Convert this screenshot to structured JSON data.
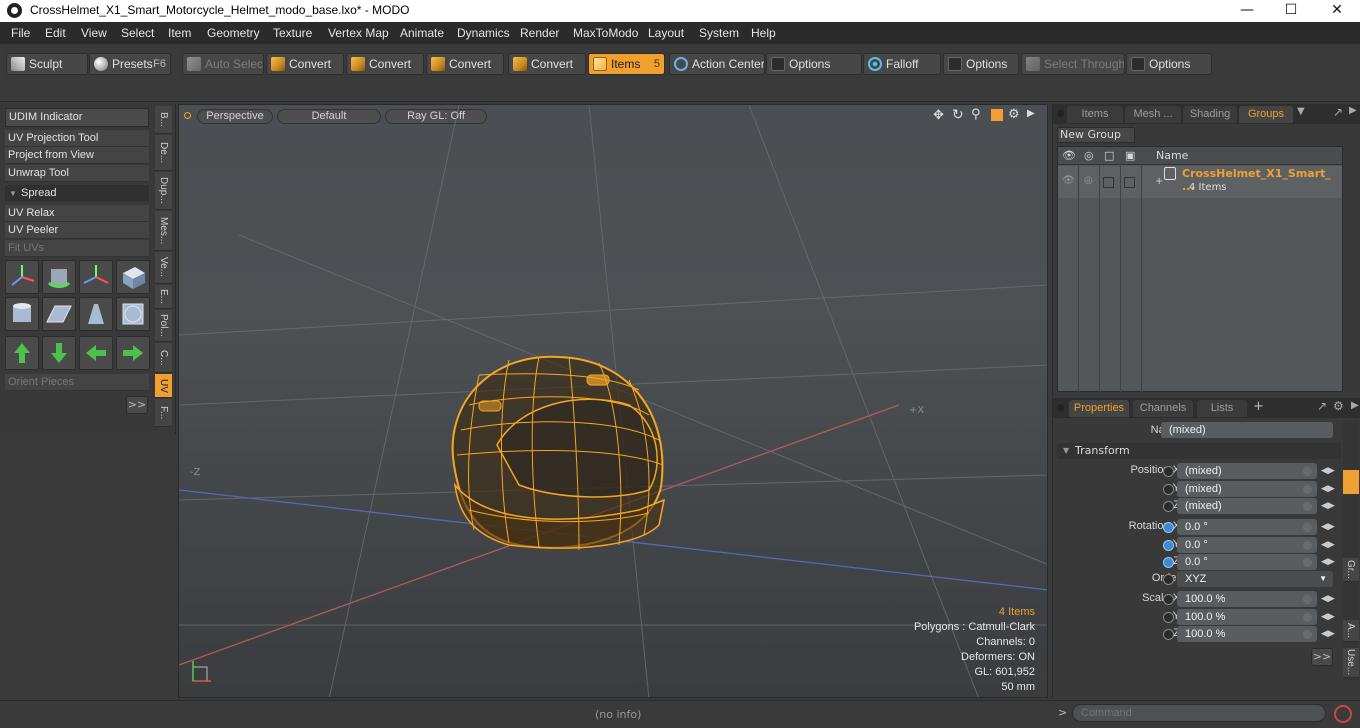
{
  "window": {
    "title": "CrossHelmet_X1_Smart_Motorcycle_Helmet_modo_base.lxo* - MODO"
  },
  "menu": [
    "File",
    "Edit",
    "View",
    "Select",
    "Item",
    "Geometry",
    "Texture",
    "Vertex Map",
    "Animate",
    "Dynamics",
    "Render",
    "MaxToModo",
    "Layout",
    "System",
    "Help"
  ],
  "toolbar": {
    "sculpt": "Sculpt",
    "presets": "Presets",
    "presets_key": "F6",
    "auto_select": "Auto Select",
    "convert1": "Convert",
    "convert2": "Convert",
    "convert3": "Convert",
    "convert4": "Convert",
    "items": "Items",
    "items_key": "5",
    "action_center": "Action Center",
    "options1": "Options",
    "falloff": "Falloff",
    "options2": "Options",
    "select_through": "Select Through",
    "options3": "Options"
  },
  "left_panel": {
    "udim": "UDIM Indicator",
    "uv_projection": "UV Projection Tool",
    "project_from_view": "Project from View",
    "unwrap": "Unwrap Tool",
    "spread": "Spread",
    "uv_relax": "UV Relax",
    "uv_peeler": "UV Peeler",
    "fit_uvs": "Fit UVs",
    "orient_pieces": "Orient Pieces",
    "more": ">>",
    "vtabs": [
      "B...",
      "De...",
      "Dup...",
      "Mes...",
      "Ve...",
      "E...",
      "Pol...",
      "C...",
      "UV",
      "F..."
    ]
  },
  "viewport": {
    "perspective": "Perspective",
    "default": "Default",
    "raygl": "Ray GL: Off",
    "axis_label_x": "+X",
    "axis_label_z": "-Z",
    "info": {
      "items": "4 Items",
      "polygons": "Polygons : Catmull-Clark",
      "channels": "Channels: 0",
      "deformers": "Deformers: ON",
      "gl": "GL: 601,952",
      "scale": "50 mm"
    },
    "colors": {
      "wire": "#f5a623",
      "grid": "#6d7175",
      "x_axis": "#b05a5a",
      "z_axis": "#5a6fc0"
    }
  },
  "groups_panel": {
    "tabs": [
      "Items",
      "Mesh ...",
      "Shading",
      "Groups"
    ],
    "new_group": "New Group",
    "col_name": "Name",
    "row_name": "CrossHelmet_X1_Smart_ ...",
    "row_sub": "4 Items"
  },
  "properties_panel": {
    "tabs": [
      "Properties",
      "Channels",
      "Lists"
    ],
    "add": "+",
    "name_label": "Name",
    "name_value": "(mixed)",
    "transform": "Transform",
    "position_x_label": "Position X",
    "y_label": "Y",
    "z_label": "Z",
    "pos_x": "(mixed)",
    "pos_y": "(mixed)",
    "pos_z": "(mixed)",
    "rotation_x_label": "Rotation X",
    "rot_x": "0.0 °",
    "rot_y": "0.0 °",
    "rot_z": "0.0 °",
    "order_label": "Order",
    "order_value": "XYZ",
    "scale_x_label": "Scale X",
    "scl_x": "100.0 %",
    "scl_y": "100.0 %",
    "scl_z": "100.0 %",
    "more": ">>",
    "side_tabs": [
      "Gr...",
      "A...",
      "Use..."
    ]
  },
  "status": {
    "info": "(no info)",
    "command_placeholder": "Command",
    "prompt": ">"
  }
}
